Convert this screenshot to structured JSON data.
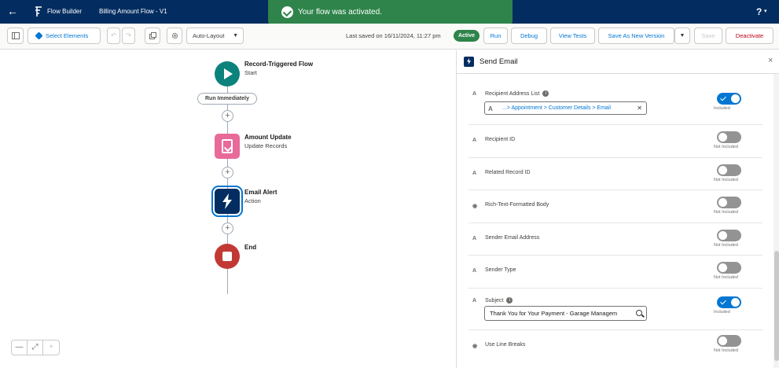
{
  "header": {
    "back_glyph": "←",
    "app_name": "Flow Builder",
    "flow_name": "Billing Amount Flow - V1",
    "help_glyph": "?",
    "help_caret": "▾"
  },
  "toast": {
    "message": "Your flow was activated."
  },
  "toolbar": {
    "select_elements": "Select Elements",
    "undo": "↶",
    "redo": "↷",
    "auto_layout": "Auto-Layout",
    "last_saved": "Last saved on 16/11/2024, 11:27 pm",
    "status": "Active",
    "run": "Run",
    "debug": "Debug",
    "view_tests": "View Tests",
    "save_as_new_version": "Save As New Version",
    "save": "Save",
    "deactivate": "Deactivate"
  },
  "canvas": {
    "start": {
      "title": "Record-Triggered Flow",
      "subtitle": "Start"
    },
    "run_pill": "Run Immediately",
    "assignment": {
      "title": "Amount Update",
      "subtitle": "Update Records"
    },
    "action": {
      "title": "Email Alert",
      "subtitle": "Action"
    },
    "end": {
      "title": "End"
    },
    "plus_glyph": "+",
    "zoom": {
      "out": "—",
      "fit": "⤢",
      "in": "+"
    }
  },
  "panel": {
    "title": "Send Email",
    "close_glyph": "×",
    "rows": [
      {
        "label": "Recipient Address List",
        "type": "A",
        "info": true,
        "toggle": "on",
        "toggle_text": "Included",
        "pill": "...> Appointment > Customer Details > Email"
      },
      {
        "label": "Recipient ID",
        "type": "A",
        "toggle": "off",
        "toggle_text": "Not Included"
      },
      {
        "label": "Related Record ID",
        "type": "A",
        "toggle": "off",
        "toggle_text": "Not Included"
      },
      {
        "label": "Rich-Text-Formatted Body",
        "type": "◉",
        "toggle": "off",
        "toggle_text": "Not Included"
      },
      {
        "label": "Sender Email Address",
        "type": "A",
        "toggle": "off",
        "toggle_text": "Not Included"
      },
      {
        "label": "Sender Type",
        "type": "A",
        "toggle": "off",
        "toggle_text": "Not Included"
      },
      {
        "label": "Subject",
        "type": "A",
        "info": true,
        "toggle": "on",
        "toggle_text": "Included",
        "value": "Thank You for Your Payment - Garage Managem"
      },
      {
        "label": "Use Line Breaks",
        "type": "◉",
        "toggle": "off",
        "toggle_text": "Not Included"
      }
    ],
    "pill_icon": "A"
  },
  "colors": {
    "header_bg": "#032d60",
    "toast_bg": "#2e844a",
    "brand_blue": "#0176d3",
    "start_node": "#0b827c",
    "assignment_node": "#e86a98",
    "action_node": "#032d60",
    "end_node": "#c23934"
  }
}
